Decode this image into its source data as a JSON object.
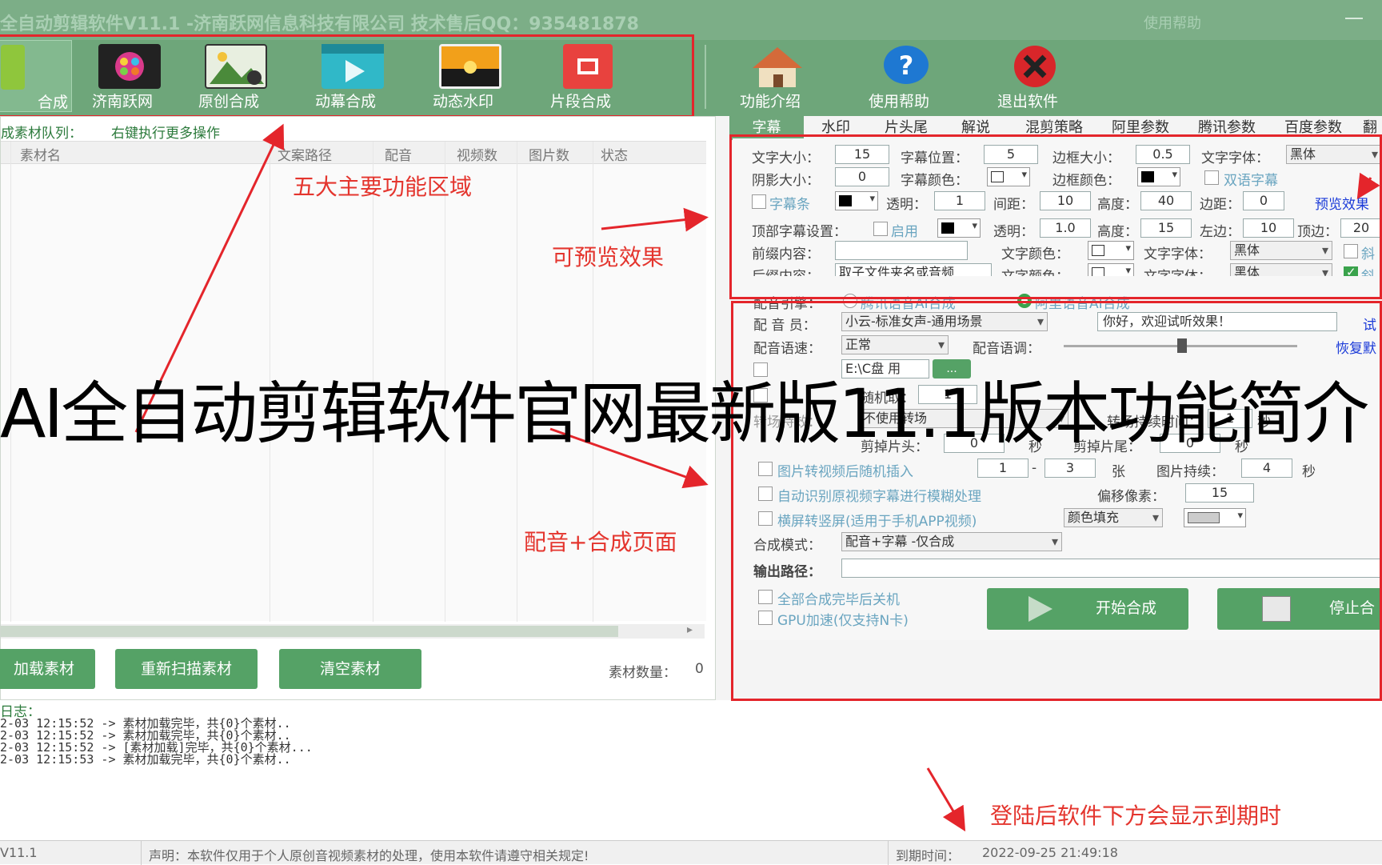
{
  "window": {
    "title": "全自动剪辑软件V11.1 -济南跃网信息科技有限公司 技术售后QQ：935481878",
    "help_link": "使用帮助"
  },
  "toolbar": {
    "items": [
      {
        "label": "合成",
        "icon": "clip-icon",
        "color": "#8fc63c"
      },
      {
        "label": "济南跃网",
        "icon": "film-reel-icon",
        "color": "#222222"
      },
      {
        "label": "原创合成",
        "icon": "landscape-image-icon",
        "color": "#e8efe0"
      },
      {
        "label": "动幕合成",
        "icon": "video-play-icon",
        "color": "#30b8c8"
      },
      {
        "label": "动态水印",
        "icon": "sunset-image-icon",
        "color": "#f2a01a"
      },
      {
        "label": "片段合成",
        "icon": "film-segment-icon",
        "color": "#e8423e"
      },
      {
        "label": "功能介绍",
        "icon": "home-icon",
        "color": "#d46a3a"
      },
      {
        "label": "使用帮助",
        "icon": "question-icon",
        "color": "#1e78d2"
      },
      {
        "label": "退出软件",
        "icon": "close-icon",
        "color": "#d8262a"
      }
    ]
  },
  "left_panel": {
    "queue_title": "成素材队列：",
    "queue_hint": "右键执行更多操作",
    "columns": [
      "素材名",
      "文案路径",
      "配音",
      "视频数",
      "图片数",
      "状态"
    ],
    "buttons": {
      "load": "加载素材",
      "rescan": "重新扫描素材",
      "clear": "清空素材"
    },
    "count_label": "素材数量：",
    "count_value": "0"
  },
  "tabs": [
    "字幕",
    "水印",
    "片头尾",
    "解说",
    "混剪策略",
    "阿里参数",
    "腾讯参数",
    "百度参数",
    "翻"
  ],
  "subtitle": {
    "font_size_label": "文字大小：",
    "font_size": "15",
    "position_label": "字幕位置：",
    "position": "5",
    "border_size_label": "边框大小：",
    "border_size": "0.5",
    "font_label": "文字字体：",
    "font": "黑体",
    "shadow_label": "阴影大小：",
    "shadow": "0",
    "color_label": "字幕颜色：",
    "border_color_label": "边框颜色：",
    "bilingual": "双语字幕",
    "bar_label": "字幕条",
    "opacity_label": "透明：",
    "opacity": "1",
    "spacing_label": "间距：",
    "spacing": "10",
    "height_label": "高度：",
    "height": "40",
    "margin_label": "边距：",
    "margin": "0",
    "preview": "预览效果",
    "top_label": "顶部字幕设置：",
    "enable": "启用",
    "top_opacity": "1.0",
    "top_height": "15",
    "left_label": "左边：",
    "left": "10",
    "top_pos_label": "顶边：",
    "top_pos": "20",
    "prefix_label": "前缀内容：",
    "prefix": "",
    "suffix_label": "后缀内容：",
    "suffix": "取子文件夹名或音频",
    "text_color_label": "文字颜色：",
    "font2": "黑体",
    "font3": "黑体",
    "italic": "斜"
  },
  "dubbing": {
    "engine_label": "配音引擎：",
    "engine_tencent": "腾讯语音AI合成",
    "engine_ali": "阿里语音AI合成",
    "voice_label": "配 音 员：",
    "voice": "小云-标准女声-通用场景",
    "test_text": "你好，欢迎试听效果！",
    "try_link": "试",
    "speed_label": "配音语速：",
    "speed": "正常",
    "pitch_label": "配音语调：",
    "pitch": 0.5,
    "reset_link": "恢复默",
    "bg_path": "E:\\C盘 用",
    "bg_btn": "...",
    "random_label": "随机取：",
    "random_val": "1",
    "transition_label": "转场特效：",
    "transition": "不使用转场",
    "transition_time_label": "转场持续时间：",
    "transition_time": "1",
    "sec": "秒",
    "cut_head_label": "剪掉片头：",
    "cut_head": "0",
    "cut_tail_label": "剪掉片尾：",
    "cut_tail": "0",
    "img_insert_label": "图片转视频后随机插入",
    "img_min": "1",
    "img_max": "3",
    "zhang": "张",
    "img_duration_label": "图片持续：",
    "img_duration": "4",
    "blur_label": "自动识别原视频字幕进行模糊处理",
    "offset_label": "偏移像素：",
    "offset": "15",
    "vertical_label": "横屏转竖屏(适用于手机APP视频)",
    "fill": "颜色填充",
    "mode_label": "合成模式：",
    "mode": "配音+字幕 -仅合成",
    "output_label": "输出路径：",
    "output": "",
    "shutdown_label": "全部合成完毕后关机",
    "gpu_label": "GPU加速(仅支持N卡)",
    "start_btn": "开始合成",
    "stop_btn": "停止合"
  },
  "log": {
    "title": "日志：",
    "lines": [
      "2-03 12:15:52 -> 素材加载完毕，共{0}个素材..",
      "2-03 12:15:52 -> 素材加载完毕，共{0}个素材..",
      "2-03 12:15:52 -> [素材加载]完毕，共{0}个素材...",
      "2-03 12:15:53 -> 素材加载完毕，共{0}个素材.."
    ]
  },
  "status": {
    "version": "V11.1",
    "notice": "声明：本软件仅用于个人原创音视频素材的处理，使用本软件请遵守相关规定!",
    "expire_label": "到期时间：",
    "expire": "2022-09-25 21:49:18"
  },
  "annotations": {
    "five_areas": "五大主要功能区域",
    "preview": "可预览效果",
    "dubbing_page": "配音+合成页面",
    "expire_note": "登陆后软件下方会显示到期时",
    "banner": "AI全自动剪辑软件官网最新版11.1版本功能简介"
  }
}
